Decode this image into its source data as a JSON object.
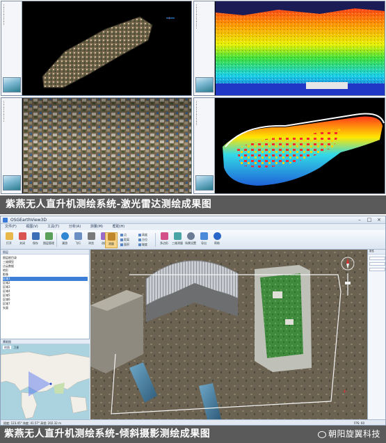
{
  "top_caption": "紫燕无人直升机测绘系统-激光雷达测绘成果图",
  "bottom_caption": "紫燕无人直升机测绘系统-倾斜摄影测绘成果图",
  "watermark": "朝阳旋翼科技",
  "app": {
    "title": "OSGEarthView3D",
    "menu": [
      "文件(F)",
      "视图(V)",
      "工具(T)",
      "分析(A)",
      "测量(M)",
      "帮助(H)"
    ],
    "ribbon_buttons": [
      "打开",
      "关闭",
      "保存",
      "图层管理",
      "漫游",
      "飞行",
      "浏览",
      "选择",
      "测量",
      "多边形",
      "三维测量",
      "场景设置",
      "导出",
      "帮助"
    ],
    "ribbon_small": [
      "点",
      "距离",
      "面积",
      "高度",
      "方位",
      "坡度"
    ],
    "panel_title": "图层",
    "layer_tree": [
      "图层根目录",
      "  三维模型",
      "  点云数据",
      "  地形",
      "  影像",
      "    区域1",
      "    区域2",
      "    区域3",
      "    区域4",
      "    区域5",
      "    区域6",
      "    区域7",
      "  矢量"
    ],
    "map_panel_title": "鹰眼图",
    "map_tabs": [
      "地图",
      "卫星"
    ],
    "right_panel_title": "属性",
    "statusbar": "经度: 123.45°  纬度: 41.57°  高程: 202.32 m",
    "statusbar_right": "FPS: 60"
  },
  "colors": {
    "caption_band": "#5a5a5a",
    "window_chrome": "#dfe7f1",
    "selected": "#3d7fd6"
  }
}
